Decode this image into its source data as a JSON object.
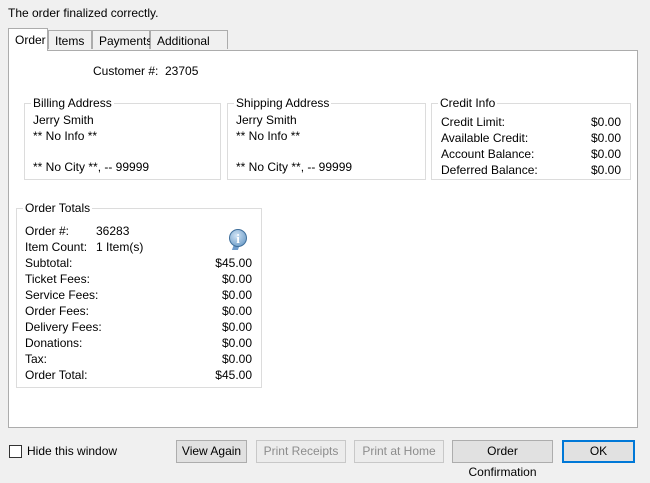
{
  "message": "The order finalized correctly.",
  "tabs": [
    {
      "label": "Order"
    },
    {
      "label": "Items"
    },
    {
      "label": "Payments"
    },
    {
      "label": "Additional Info"
    }
  ],
  "customer": {
    "label": "Customer #:",
    "value": "23705"
  },
  "billing": {
    "title": "Billing Address",
    "name": "Jerry Smith",
    "info": "** No Info **",
    "city": "** No City **, -- 99999"
  },
  "shipping": {
    "title": "Shipping Address",
    "name": "Jerry Smith",
    "info": "** No Info **",
    "city": "** No City **, -- 99999"
  },
  "credit": {
    "title": "Credit Info",
    "rows": [
      {
        "label": "Credit Limit:",
        "value": "$0.00"
      },
      {
        "label": "Available Credit:",
        "value": "$0.00"
      },
      {
        "label": "Account Balance:",
        "value": "$0.00"
      },
      {
        "label": "Deferred Balance:",
        "value": "$0.00"
      }
    ]
  },
  "totals": {
    "title": "Order Totals",
    "order_label": "Order #:",
    "order_value": "36283",
    "count_label": "Item Count:",
    "count_value": "1 Item(s)",
    "info_icon": "info-icon",
    "rows": [
      {
        "label": "Subtotal:",
        "value": "$45.00"
      },
      {
        "label": "Ticket Fees:",
        "value": "$0.00"
      },
      {
        "label": "Service Fees:",
        "value": "$0.00"
      },
      {
        "label": "Order Fees:",
        "value": "$0.00"
      },
      {
        "label": "Delivery Fees:",
        "value": "$0.00"
      },
      {
        "label": "Donations:",
        "value": "$0.00"
      },
      {
        "label": "Tax:",
        "value": "$0.00"
      },
      {
        "label": "Order Total:",
        "value": "$45.00"
      }
    ]
  },
  "footer": {
    "hide_label": "Hide this window",
    "hide_checked": false,
    "view_again": "View Again",
    "print_receipts": "Print Receipts",
    "print_home": "Print at Home",
    "order_confirmation": "Order Confirmation",
    "ok": "OK"
  }
}
